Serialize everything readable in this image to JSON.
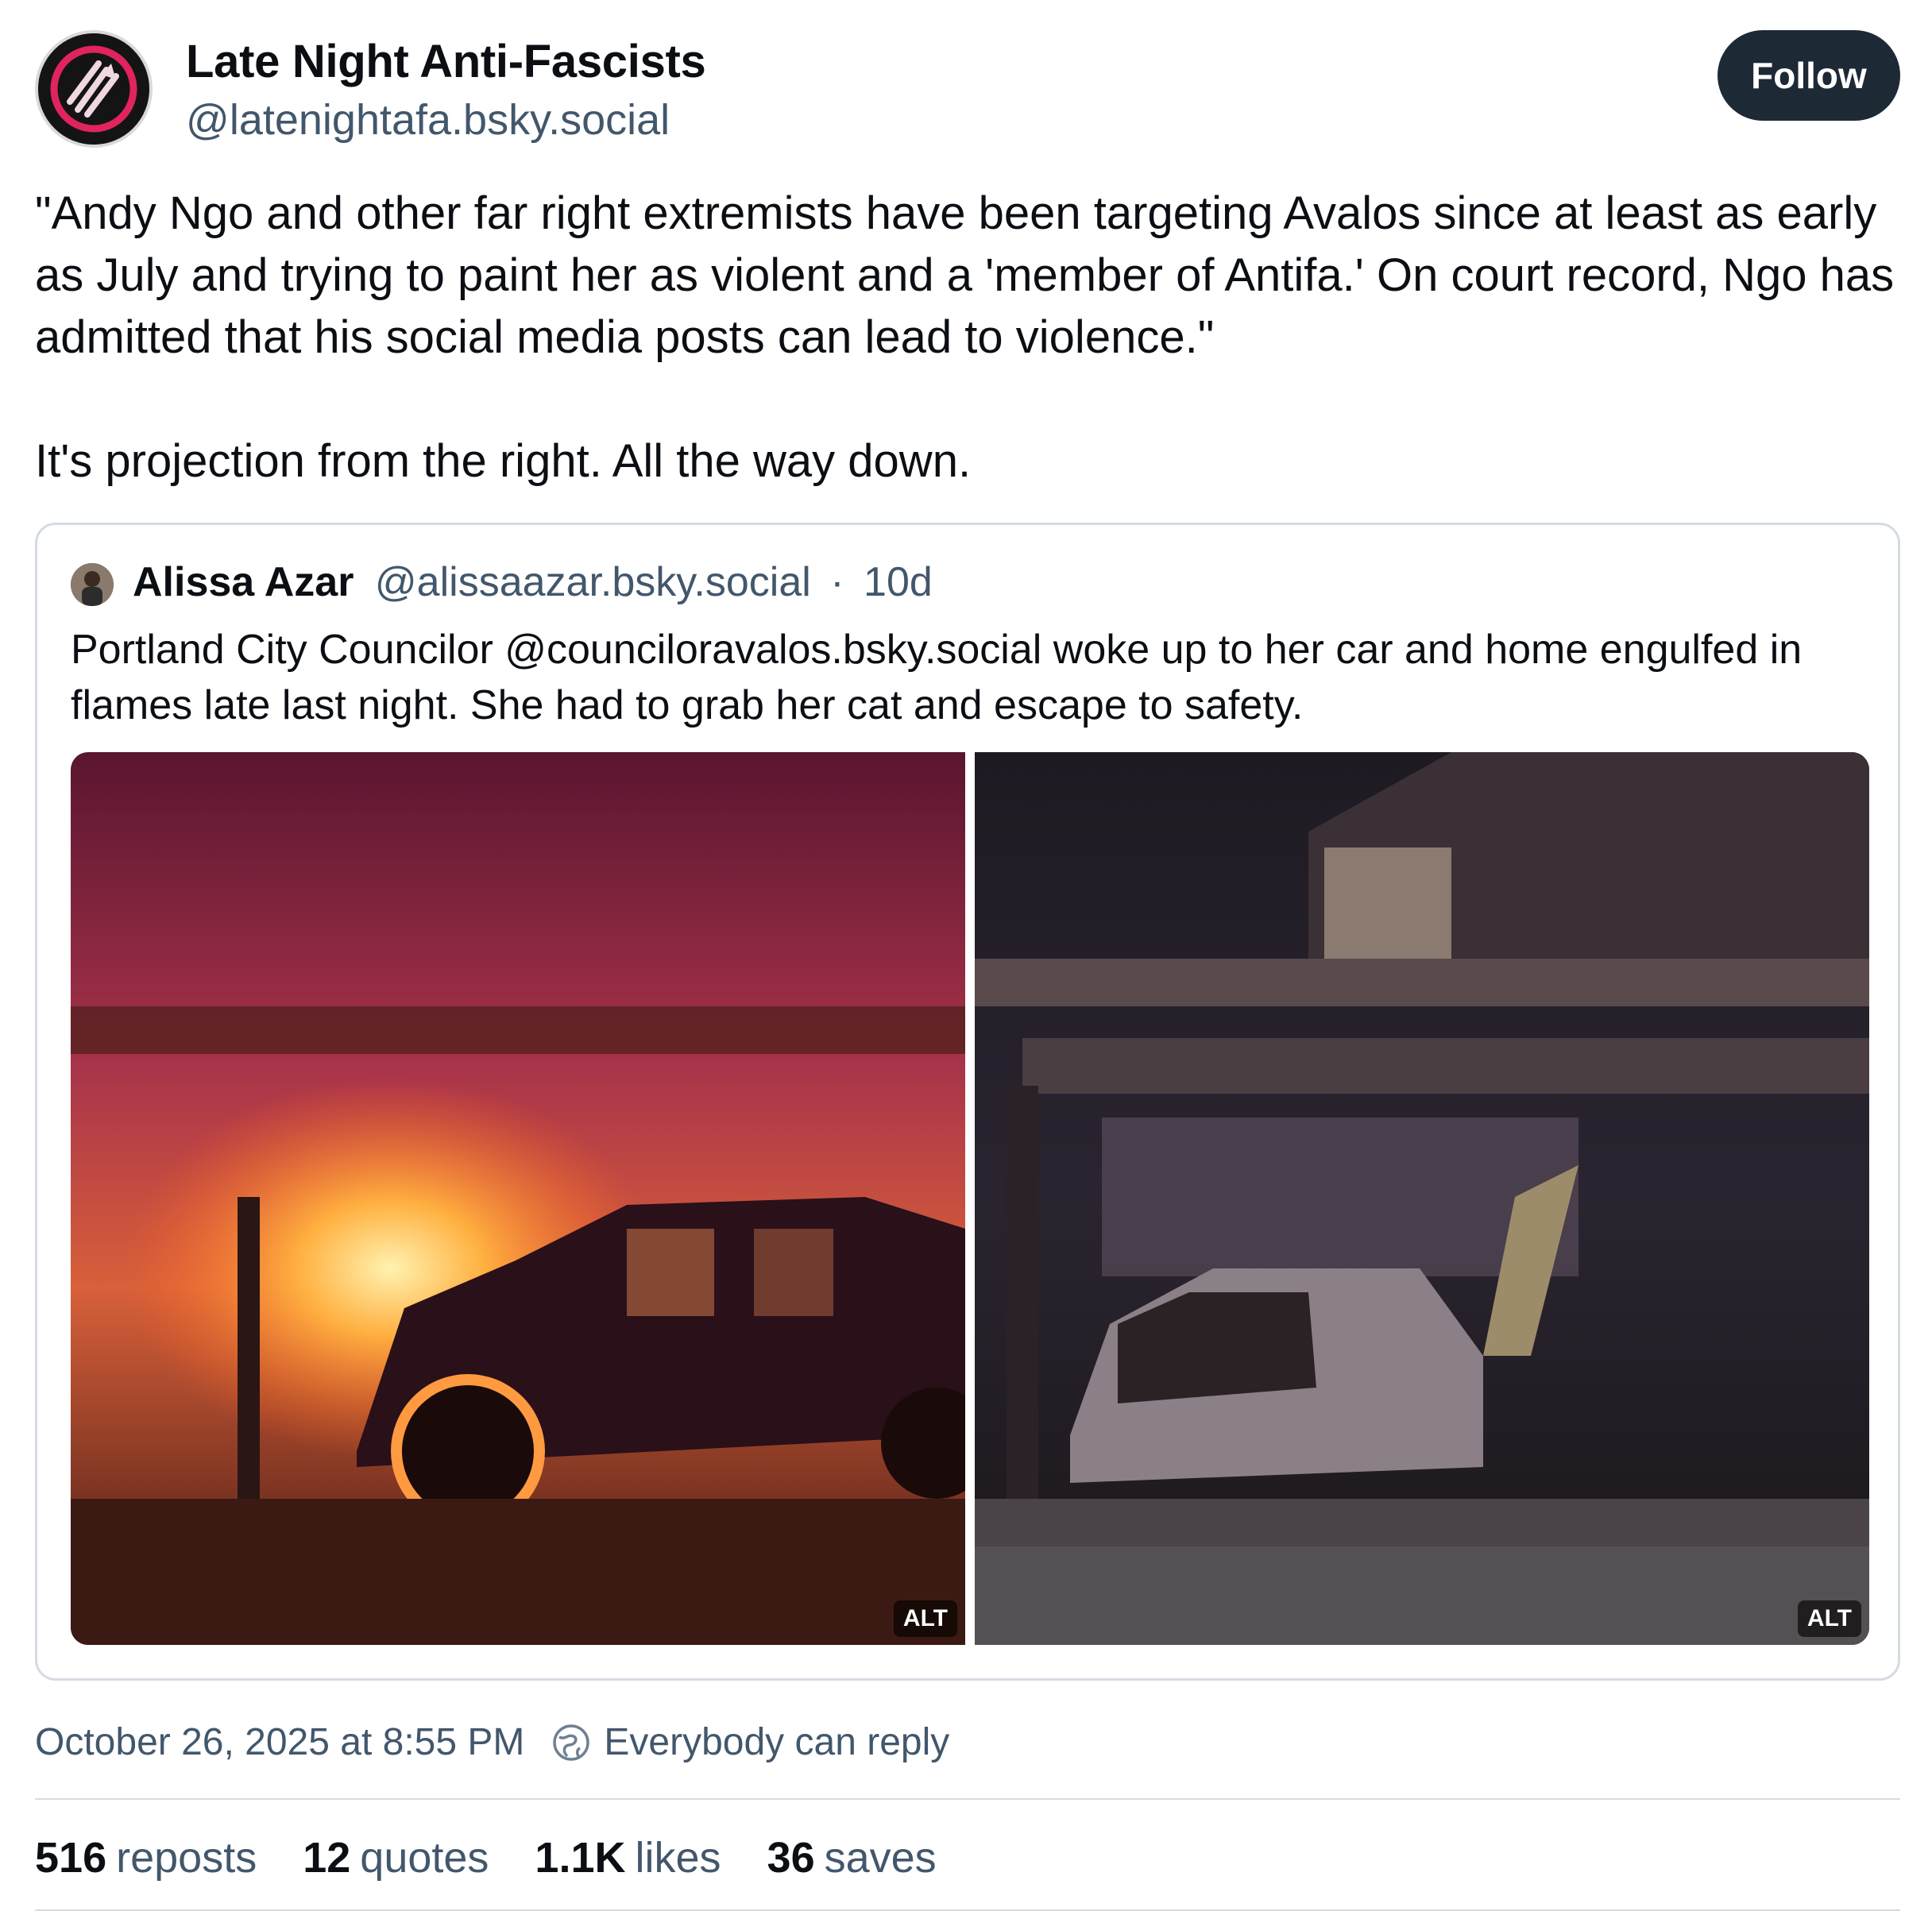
{
  "post": {
    "author": {
      "name": "Late Night Anti-Fascists",
      "handle": "@latenightafa.bsky.social",
      "avatar_icon": "three-arrows-icon"
    },
    "follow_label": "Follow",
    "paragraphs": [
      "\"Andy Ngo and other far right extremists have been targeting Avalos since at least as early as July and trying to paint her as violent and a 'member of Antifa.' On court record, Ngo has admitted that his social media posts can lead to violence.\"",
      "It's projection from the right. All the way down."
    ],
    "timestamp": "October 26, 2025 at 8:55 PM",
    "reply_setting": "Everybody can reply",
    "stats": [
      {
        "count": "516",
        "label": "reposts"
      },
      {
        "count": "12",
        "label": "quotes"
      },
      {
        "count": "1.1K",
        "label": "likes"
      },
      {
        "count": "36",
        "label": "saves"
      }
    ]
  },
  "quote": {
    "author_name": "Alissa Azar",
    "author_handle": "@alissaazar.bsky.social",
    "separator": "·",
    "age": "10d",
    "text": "Portland City Councilor @counciloravalos.bsky.social woke up to her car and home engulfed in flames late last night. She had to grab her cat and escape to safety.",
    "images": [
      {
        "alt_label": "ALT"
      },
      {
        "alt_label": "ALT"
      }
    ]
  },
  "colors": {
    "follow_bg": "#1e2936",
    "secondary_text": "#42576c",
    "border": "#d4dbe2",
    "avatar_accent": "#e0245e"
  }
}
